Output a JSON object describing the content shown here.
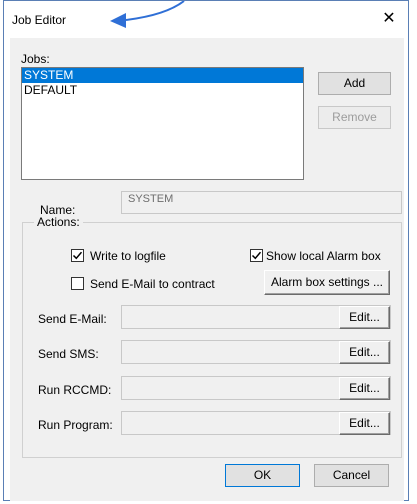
{
  "window": {
    "title": "Job Editor",
    "close_glyph": "✕"
  },
  "jobs": {
    "label": "Jobs:",
    "items": [
      "SYSTEM",
      "DEFAULT"
    ],
    "selected_index": 0,
    "add_label": "Add",
    "remove_label": "Remove"
  },
  "name": {
    "label": "Name:",
    "value": "SYSTEM"
  },
  "actions": {
    "label": "Actions:",
    "write_logfile": {
      "label": "Write to logfile",
      "checked": true
    },
    "show_alarm": {
      "label": "Show local Alarm box",
      "checked": true
    },
    "send_email_contract": {
      "label": "Send E-Mail to contract",
      "checked": false
    },
    "alarm_settings_label": "Alarm box settings ...",
    "rows": [
      {
        "label": "Send E-Mail:",
        "value": "",
        "button": "Edit..."
      },
      {
        "label": "Send SMS:",
        "value": "",
        "button": "Edit..."
      },
      {
        "label": "Run RCCMD:",
        "value": "",
        "button": "Edit..."
      },
      {
        "label": "Run Program:",
        "value": "",
        "button": "Edit..."
      }
    ]
  },
  "footer": {
    "ok_label": "OK",
    "cancel_label": "Cancel"
  },
  "colors": {
    "selection": "#0078d7",
    "window_border": "#5a7fb5",
    "arrow": "#2f6fd6"
  }
}
